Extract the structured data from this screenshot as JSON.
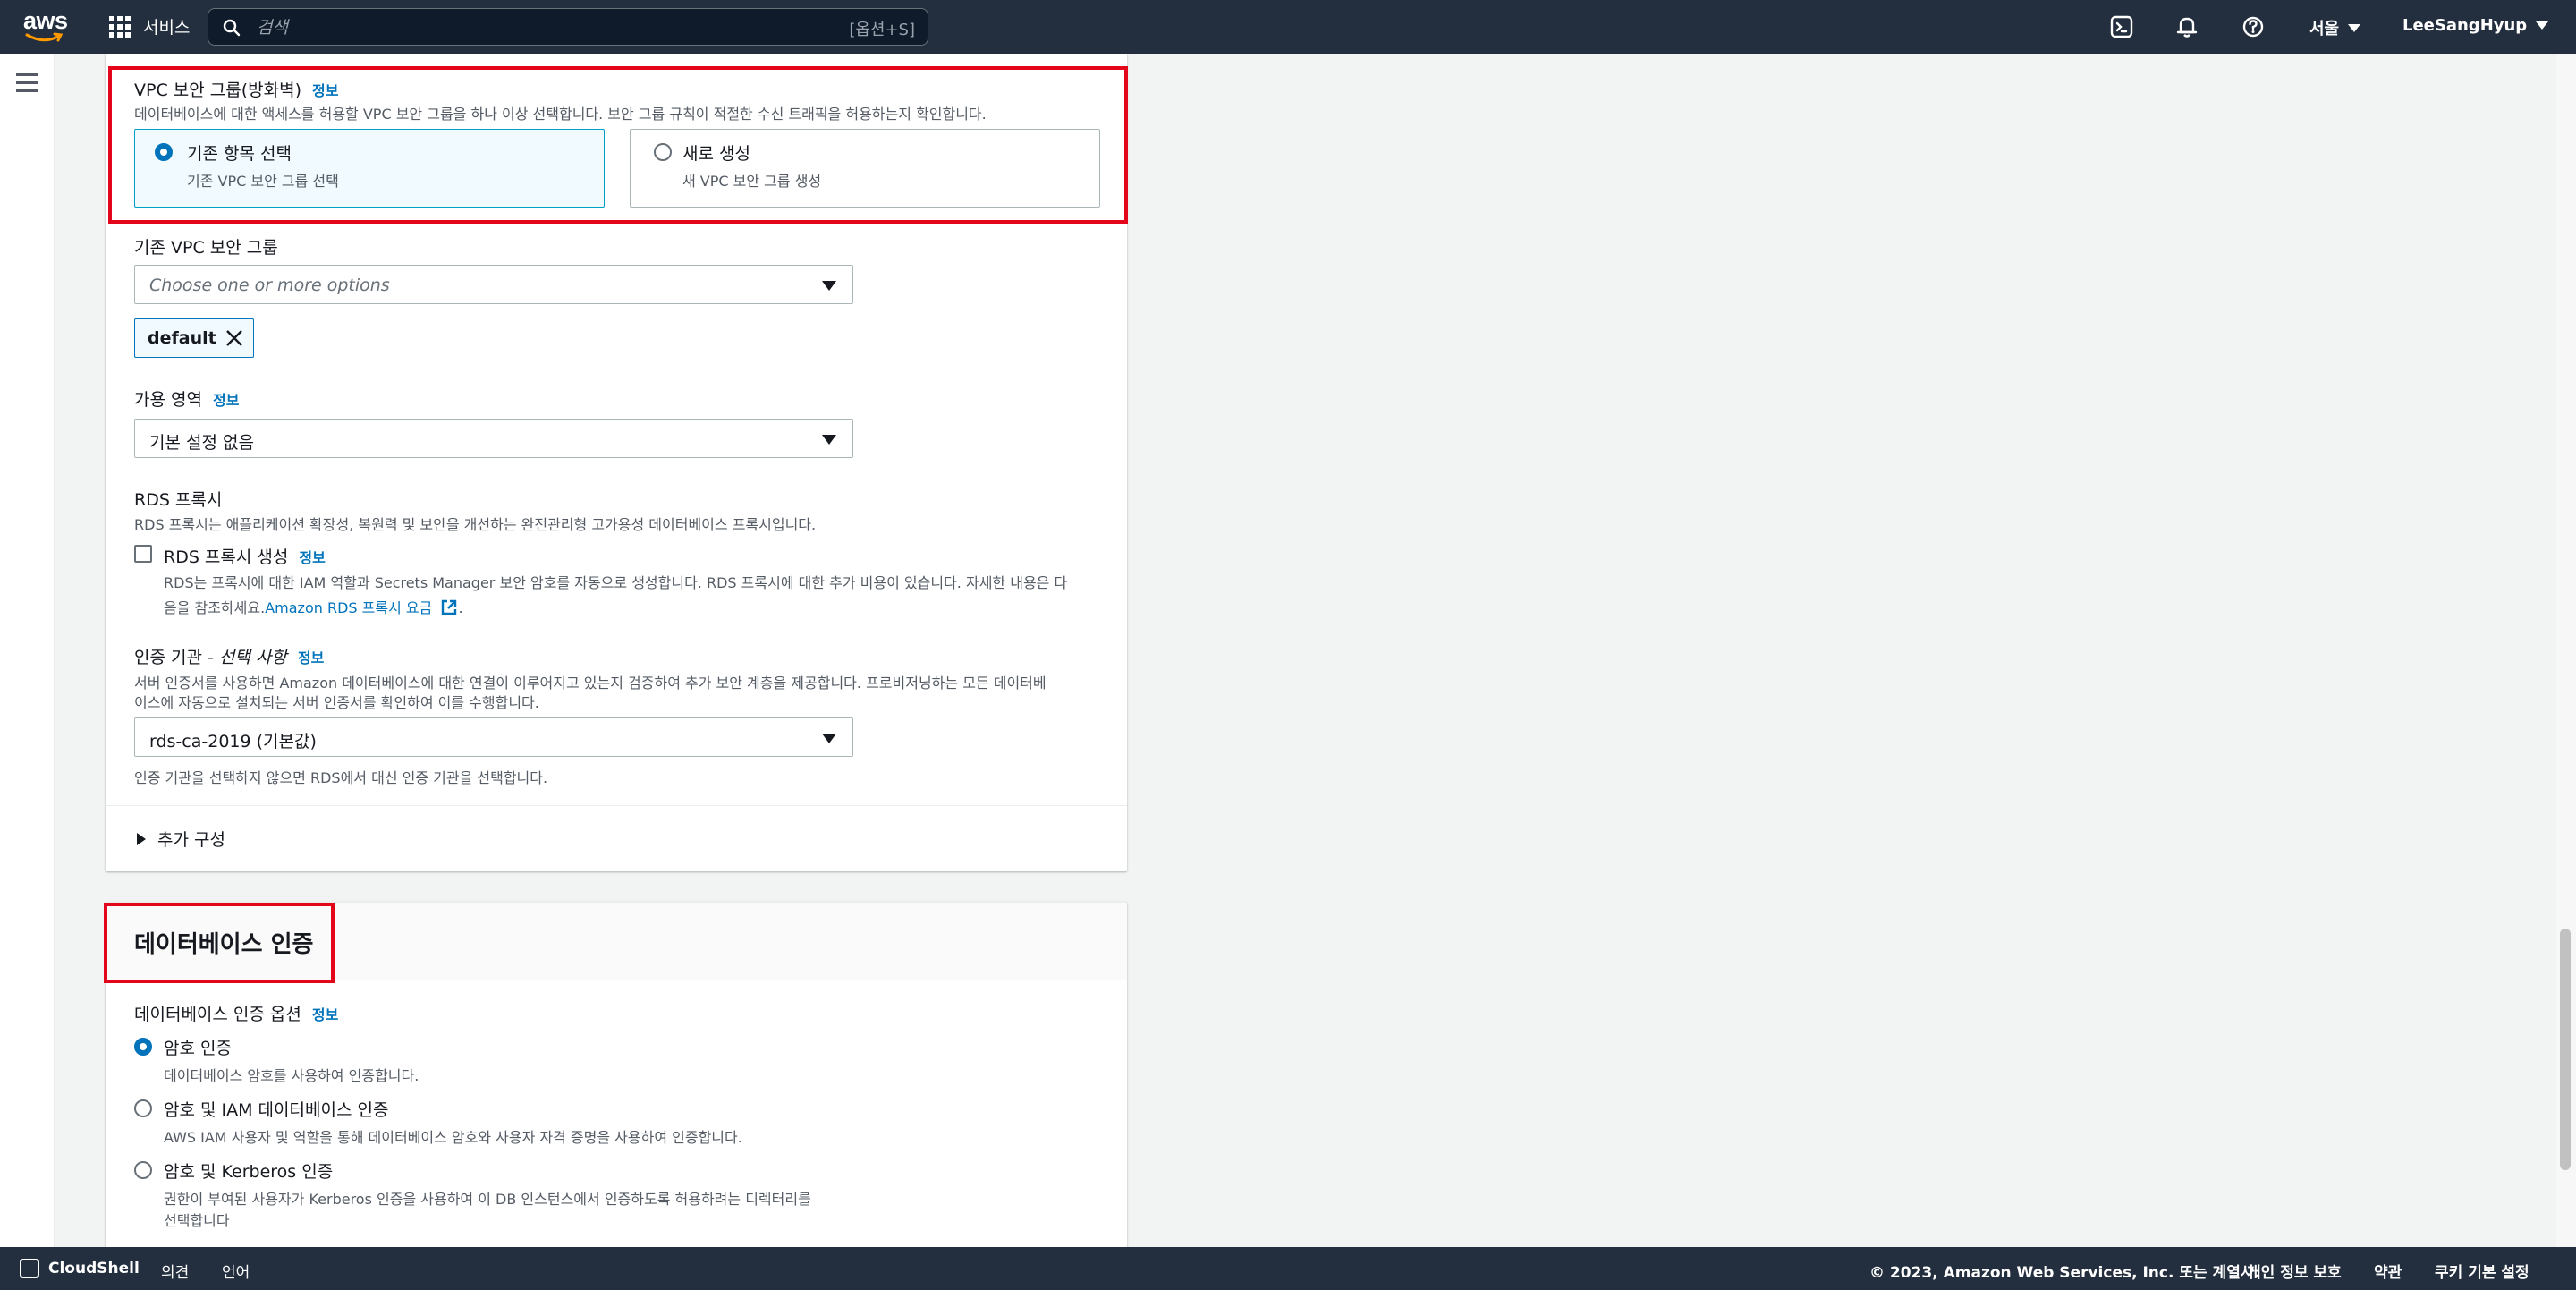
{
  "topnav": {
    "logo": "aws",
    "services_label": "서비스",
    "search_placeholder": "검색",
    "search_shortcut": "[옵션+S]",
    "region": "서울",
    "user": "LeeSangHyup",
    "icons": [
      "cloudshell-icon",
      "bell-icon",
      "help-icon"
    ]
  },
  "security_group": {
    "title": "VPC 보안 그룹(방화벽)",
    "info": "정보",
    "description": "데이터베이스에 대한 액세스를 허용할 VPC 보안 그룹을 하나 이상 선택합니다. 보안 그룹 규칙이 적절한 수신 트래픽을 허용하는지 확인합니다.",
    "options": [
      {
        "title": "기존 항목 선택",
        "subtitle": "기존 VPC 보안 그룹 선택",
        "selected": true
      },
      {
        "title": "새로 생성",
        "subtitle": "새 VPC 보안 그룹 생성",
        "selected": false
      }
    ]
  },
  "existing_sg": {
    "label": "기존 VPC 보안 그룹",
    "placeholder": "Choose one or more options",
    "token": "default"
  },
  "az": {
    "label": "가용 영역",
    "info": "정보",
    "value": "기본 설정 없음"
  },
  "rds_proxy": {
    "title": "RDS 프록시",
    "description": "RDS 프록시는 애플리케이션 확장성, 복원력 및 보안을 개선하는 완전관리형 고가용성 데이터베이스 프록시입니다.",
    "checkbox_label": "RDS 프록시 생성",
    "info": "정보",
    "checkbox_desc_1": "RDS는 프록시에 대한 IAM 역할과 Secrets Manager 보안 암호를 자동으로 생성합니다. RDS 프록시에 대한 추가 비용이 있습니다. 자세한 내용은 다",
    "checkbox_desc_2": "음을 참조하세요.",
    "link": "Amazon RDS 프록시 요금",
    "link_suffix": "."
  },
  "cert": {
    "label": "인증 기관 - ",
    "label_optional": "선택 사항",
    "info": "정보",
    "description_1": "서버 인증서를 사용하면 Amazon 데이터베이스에 대한 연결이 이루어지고 있는지 검증하여 추가 보안 계층을 제공합니다. 프로비저닝하는 모든 데이터베",
    "description_2": "이스에 자동으로 설치되는 서버 인증서를 확인하여 이를 수행합니다.",
    "value": "rds-ca-2019 (기본값)",
    "hint": "인증 기관을 선택하지 않으면 RDS에서 대신 인증 기관을 선택합니다."
  },
  "additional_config": "추가 구성",
  "db_auth": {
    "title": "데이터베이스 인증",
    "options_label": "데이터베이스 인증 옵션",
    "info": "정보",
    "options": [
      {
        "title": "암호 인증",
        "desc": "데이터베이스 암호를 사용하여 인증합니다.",
        "selected": true
      },
      {
        "title": "암호 및 IAM 데이터베이스 인증",
        "desc": "AWS IAM 사용자 및 역할을 통해 데이터베이스 암호와 사용자 자격 증명을 사용하여 인증합니다.",
        "selected": false
      },
      {
        "title": "암호 및 Kerberos 인증",
        "desc": "권한이 부여된 사용자가 Kerberos 인증을 사용하여 이 DB 인스턴스에서 인증하도록 허용하려는 디렉터리를",
        "desc2": "선택합니다",
        "selected": false
      }
    ]
  },
  "footer": {
    "cloudshell": "CloudShell",
    "feedback": "의견",
    "language": "언어",
    "copyright": "© 2023, Amazon Web Services, Inc. 또는 계열사.",
    "privacy": "개인 정보 보호",
    "terms": "약관",
    "cookies": "쿠키 기본 설정"
  },
  "colors": {
    "nav_bg": "#232f3e",
    "accent": "#0073bb",
    "highlight": "#e3061b"
  }
}
